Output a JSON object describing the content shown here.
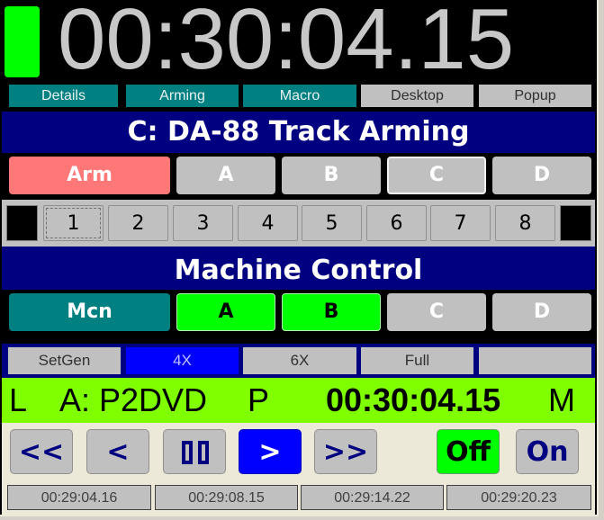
{
  "clock": {
    "timecode": "00:30:04.15",
    "indicator_color": "#00ff00"
  },
  "nav_tabs": [
    {
      "label": "Details",
      "style": "teal"
    },
    {
      "label": "Arming",
      "style": "teal"
    },
    {
      "label": "Macro",
      "style": "teal"
    },
    {
      "label": "Desktop",
      "style": "grey"
    },
    {
      "label": "Popup",
      "style": "grey"
    }
  ],
  "track_arming": {
    "title": "C: DA-88  Track Arming",
    "buttons": [
      {
        "label": "Arm",
        "state": "active"
      },
      {
        "label": "A",
        "state": "off"
      },
      {
        "label": "B",
        "state": "off"
      },
      {
        "label": "C",
        "state": "selected"
      },
      {
        "label": "D",
        "state": "off"
      }
    ],
    "tracks": [
      "1",
      "2",
      "3",
      "4",
      "5",
      "6",
      "7",
      "8"
    ],
    "focused_track": "1"
  },
  "machine_control": {
    "title": "Machine Control",
    "buttons": [
      {
        "label": "Mcn",
        "state": "mode"
      },
      {
        "label": "A",
        "state": "on"
      },
      {
        "label": "B",
        "state": "on"
      },
      {
        "label": "C",
        "state": "off"
      },
      {
        "label": "D",
        "state": "off"
      }
    ],
    "speed_modes": [
      {
        "label": "SetGen",
        "active": false
      },
      {
        "label": "4X",
        "active": true
      },
      {
        "label": "6X",
        "active": false
      },
      {
        "label": "Full",
        "active": false
      },
      {
        "label": "",
        "active": false
      }
    ]
  },
  "status": {
    "lock": "L",
    "machine": "A: P2DVD",
    "mode": "P",
    "timecode": "00:30:04.15",
    "flag": "M",
    "color": "#80ff00"
  },
  "transport": {
    "rewind": "<<",
    "back": "<",
    "pause_icon": "pause-icon",
    "play": ">",
    "fast_forward": ">>",
    "off": "Off",
    "on": "On",
    "active": "play"
  },
  "cue_times": [
    "00:29:04.16",
    "00:29:08.15",
    "00:29:14.22",
    "00:29:20.23"
  ]
}
